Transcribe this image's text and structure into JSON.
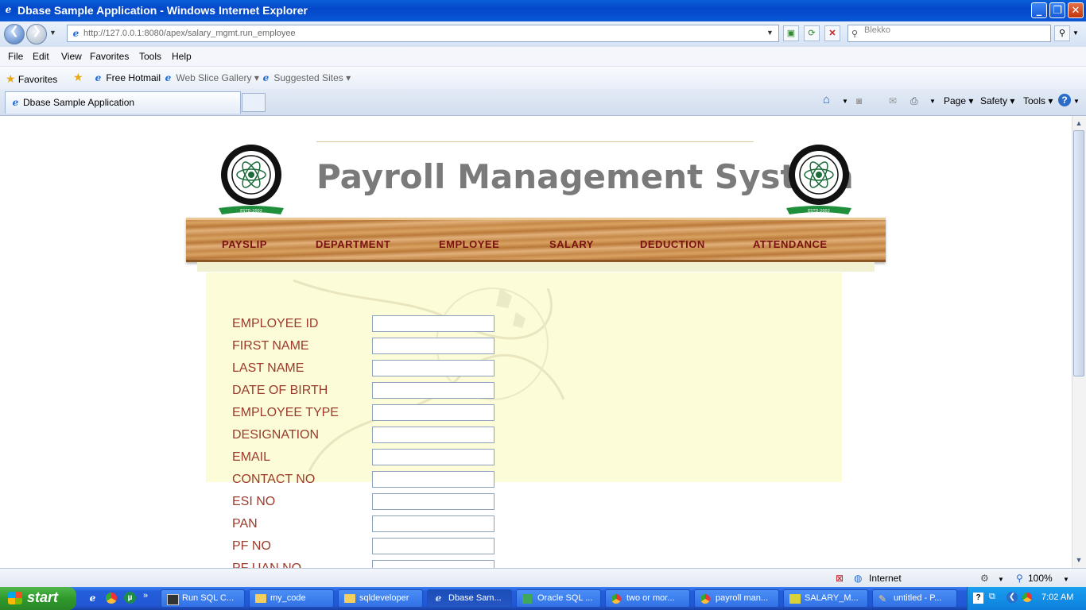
{
  "window": {
    "title": "Dbase Sample Application - Windows Internet Explorer",
    "min_label": "_",
    "max_label": "❐",
    "close_label": "✕"
  },
  "address": {
    "url": "http://127.0.0.1:8080/apex/salary_mgmt.run_employee",
    "search_placeholder": "Blekko"
  },
  "menu": [
    "File",
    "Edit",
    "View",
    "Favorites",
    "Tools",
    "Help"
  ],
  "favorites": {
    "label": "Favorites",
    "items": [
      "Free Hotmail",
      "Web Slice Gallery ▾",
      "Suggested Sites ▾"
    ]
  },
  "tabs": {
    "active": "Dbase Sample Application",
    "commands": [
      "Page ▾",
      "Safety ▾",
      "Tools ▾"
    ]
  },
  "page": {
    "title": "Payroll Management System",
    "logo_text": "ESTD-2002",
    "nav": [
      "PAYSLIP",
      "DEPARTMENT",
      "EMPLOYEE",
      "SALARY",
      "DEDUCTION",
      "ATTENDANCE"
    ],
    "fields": [
      "EMPLOYEE ID",
      "FIRST NAME",
      "LAST NAME",
      "DATE OF BIRTH",
      "EMPLOYEE TYPE",
      "DESIGNATION",
      "EMAIL",
      "CONTACT NO",
      "ESI NO",
      "PAN",
      "PF NO",
      "PF UAN NO"
    ]
  },
  "status": {
    "zone": "Internet",
    "zoom": "100%"
  },
  "taskbar": {
    "start": "start",
    "tasks": [
      "Run SQL C...",
      "my_code",
      "sqldeveloper",
      "Dbase Sam...",
      "Oracle SQL ...",
      "two or mor...",
      "payroll man...",
      "SALARY_M...",
      "untitled - P..."
    ],
    "clock": "7:02 AM"
  },
  "colors": {
    "nav_text": "#7a1212",
    "field_label": "#9a3a2a",
    "title_gray": "#7a7a7a",
    "taskbar_blue": "#245edb"
  }
}
